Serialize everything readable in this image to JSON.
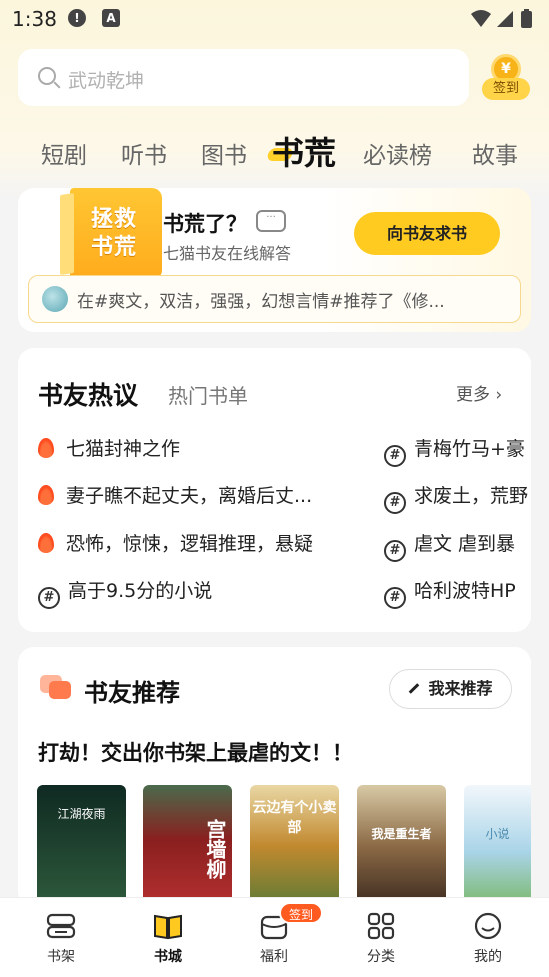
{
  "status_bar": {
    "time": "1:38"
  },
  "search": {
    "placeholder": "武动乾坤"
  },
  "signin": {
    "label": "签到",
    "coin_symbol": "¥"
  },
  "tabs": [
    {
      "label": "短剧",
      "active": false
    },
    {
      "label": "听书",
      "active": false
    },
    {
      "label": "图书",
      "active": false
    },
    {
      "label": "书荒",
      "active": true
    },
    {
      "label": "必读榜",
      "active": false
    },
    {
      "label": "故事",
      "active": false
    }
  ],
  "banner": {
    "book_text": "拯救书荒",
    "title": "书荒了？",
    "subtitle": "七猫书友在线解答",
    "button": "向书友求书",
    "quote": "在#爽文，双洁，强强，幻想言情#推荐了《修..."
  },
  "hot": {
    "title": "书友热议",
    "tab2": "热门书单",
    "more": "更多",
    "left_items": [
      {
        "icon": "fire-icon",
        "text": "七猫封神之作"
      },
      {
        "icon": "fire-icon",
        "text": "妻子瞧不起丈夫，离婚后丈..."
      },
      {
        "icon": "fire-icon",
        "text": "恐怖，惊悚，逻辑推理，悬疑"
      },
      {
        "icon": "hash-icon",
        "text": "高于9.5分的小说"
      }
    ],
    "right_items": [
      {
        "icon": "hash-icon",
        "text": "青梅竹马+豪"
      },
      {
        "icon": "hash-icon",
        "text": "求废土，荒野"
      },
      {
        "icon": "hash-icon",
        "text": "虐文 虐到暴"
      },
      {
        "icon": "hash-icon",
        "text": "哈利波特HP"
      }
    ]
  },
  "recommend": {
    "title": "书友推荐",
    "button": "我来推荐",
    "headline": "打劫！交出你书架上最虐的文！！",
    "covers": [
      {
        "title": "江湖夜雨",
        "color": "#1f3a2c"
      },
      {
        "title": "宫墙柳",
        "color": "#8a1f1f"
      },
      {
        "title": "云边有个小卖部",
        "color": "#b77a2e"
      },
      {
        "title": "我是重生者",
        "color": "#a9905f"
      },
      {
        "title": "小说",
        "color": "#9ccbe0"
      }
    ]
  },
  "bottom_nav": [
    {
      "label": "书架",
      "icon": "bookshelf-icon",
      "active": false
    },
    {
      "label": "书城",
      "icon": "book-city-icon",
      "active": true
    },
    {
      "label": "福利",
      "icon": "gift-icon",
      "active": false,
      "badge": "签到"
    },
    {
      "label": "分类",
      "icon": "category-icon",
      "active": false
    },
    {
      "label": "我的",
      "icon": "profile-icon",
      "active": false
    }
  ]
}
